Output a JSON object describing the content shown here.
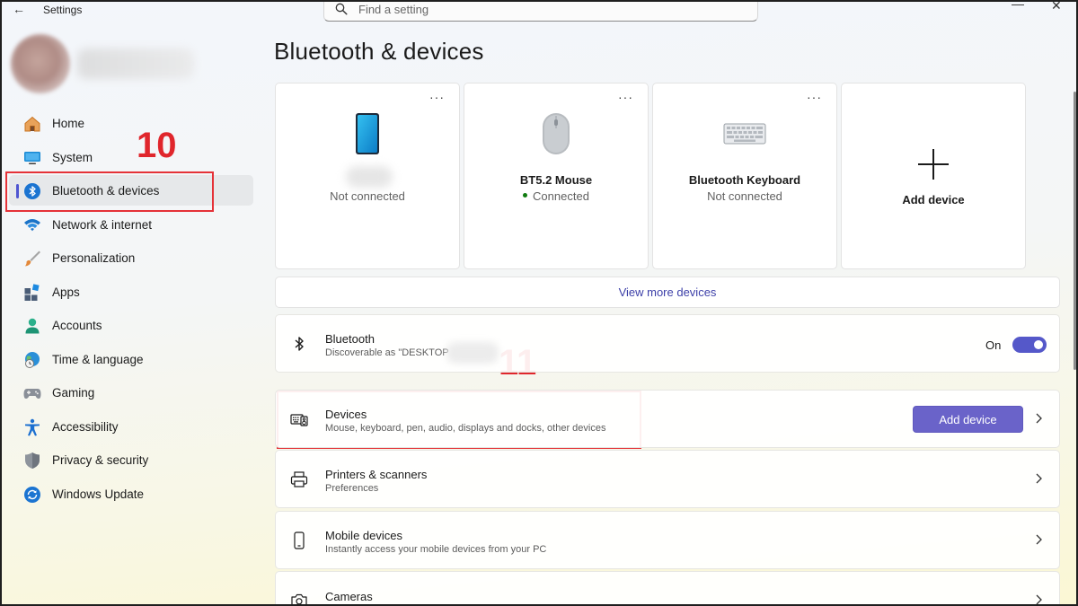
{
  "titlebar": {
    "app_title": "Settings"
  },
  "search": {
    "placeholder": "Find a setting"
  },
  "sidebar": {
    "items": [
      {
        "label": "Home",
        "icon": "home-icon"
      },
      {
        "label": "System",
        "icon": "system-icon"
      },
      {
        "label": "Bluetooth & devices",
        "icon": "bluetooth-icon",
        "selected": true
      },
      {
        "label": "Network & internet",
        "icon": "wifi-icon"
      },
      {
        "label": "Personalization",
        "icon": "brush-icon"
      },
      {
        "label": "Apps",
        "icon": "apps-icon"
      },
      {
        "label": "Accounts",
        "icon": "person-icon"
      },
      {
        "label": "Time & language",
        "icon": "globe-clock-icon"
      },
      {
        "label": "Gaming",
        "icon": "gamepad-icon"
      },
      {
        "label": "Accessibility",
        "icon": "accessibility-icon"
      },
      {
        "label": "Privacy & security",
        "icon": "shield-icon"
      },
      {
        "label": "Windows Update",
        "icon": "update-icon"
      }
    ]
  },
  "annotations": {
    "step_a": "10",
    "step_b": "11"
  },
  "main": {
    "title": "Bluetooth & devices",
    "device_cards": [
      {
        "name": "",
        "status": "Not connected",
        "icon": "phone-icon"
      },
      {
        "name": "BT5.2 Mouse",
        "status": "Connected",
        "icon": "mouse-icon",
        "connected": true
      },
      {
        "name": "Bluetooth Keyboard",
        "status": "Not connected",
        "icon": "keyboard-icon"
      }
    ],
    "more_glyph": "···",
    "add_card_label": "Add device",
    "view_more": "View more devices",
    "bluetooth_row": {
      "title": "Bluetooth",
      "subtitle": "Discoverable as \"DESKTOP",
      "toggle_label": "On",
      "toggle_on": true
    },
    "devices_row": {
      "title": "Devices",
      "subtitle": "Mouse, keyboard, pen, audio, displays and docks, other devices",
      "button": "Add device"
    },
    "printers_row": {
      "title": "Printers & scanners",
      "subtitle": "Preferences"
    },
    "mobile_row": {
      "title": "Mobile devices",
      "subtitle": "Instantly access your mobile devices from your PC"
    },
    "cameras_row": {
      "title": "Cameras"
    }
  },
  "colors": {
    "accent": "#5558c9",
    "button": "#6a63c9",
    "annotation": "#e53238",
    "connected": "#0f7b0f"
  }
}
